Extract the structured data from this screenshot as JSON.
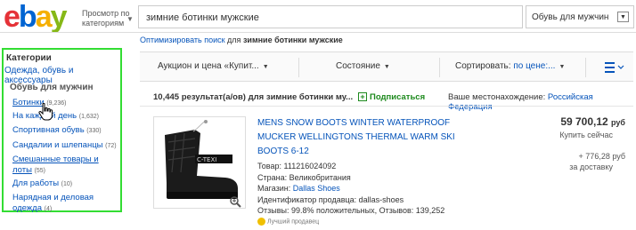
{
  "header": {
    "logo": {
      "e": "e",
      "b": "b",
      "a": "a",
      "y": "y"
    },
    "browse_line1": "Просмотр по",
    "browse_line2": "категориям",
    "search_value": "зимние ботинки мужские",
    "category_select": "Обувь для мужчин"
  },
  "spellbar": {
    "link": "Оптимизировать поиск",
    "text": " для ",
    "query": "зимние ботинки мужские"
  },
  "sidebar": {
    "title": "Категории",
    "top_category": "Одежда, обувь и аксессуары",
    "subtitle": "Обувь для мужчин",
    "items": [
      {
        "label": "Ботинки",
        "count": "(9,236)"
      },
      {
        "label": "На каждый день",
        "count": "(1,632)"
      },
      {
        "label": "Спортивная обувь",
        "count": "(330)"
      },
      {
        "label": "Сандалии и шлепанцы",
        "count": "(72)"
      },
      {
        "label_line1": "Смешанные товары и",
        "label_line2": "лоты",
        "count": "(55)"
      },
      {
        "label": "Для работы",
        "count": "(10)"
      },
      {
        "label_line1": "Нарядная и деловая",
        "label_line2": "одежда",
        "count": "(4)"
      }
    ],
    "border_color": "#33dd33"
  },
  "sortbar": {
    "format": "Аукцион и цена «Купит...",
    "condition": "Состояние",
    "sort_label": "Сортировать:",
    "sort_value": "по цене:..."
  },
  "results": {
    "count_text": "10,445 результат(а/ов) для",
    "query": "зимние ботинки му...",
    "follow": "Подписаться",
    "location_label": "Ваше местонахождение:",
    "location_value": "Российская Федерация"
  },
  "item": {
    "title_line1": "MENS SNOW BOOTS WINTER WATERPROOF",
    "title_line2": "MUCKER WELLINGTONS THERMAL WARM SKI",
    "title_line3": "BOOTS 6-12",
    "image_brand": "C-TEXI",
    "product_label": "Товар:",
    "product_value": "111216024092",
    "country_label": "Страна:",
    "country_value": "Великобритания",
    "shop_label": "Магазин:",
    "shop_value": "Dallas Shoes",
    "seller_id_label": "Идентификатор продавца:",
    "seller_id_value": "dallas-shoes",
    "reviews": "Отзывы: 99.8% положительных, Отзывов: 139,252",
    "price": "59 700,12",
    "price_currency": "руб",
    "buy_now": "Купить сейчас",
    "shipping_line1": "+ 776,28 руб",
    "shipping_line2": "за доставку",
    "badge": "Лучший продавец"
  },
  "colors": {
    "link": "#0654ba",
    "accent_green": "#1e8a1e",
    "highlight_border": "#33dd33"
  }
}
